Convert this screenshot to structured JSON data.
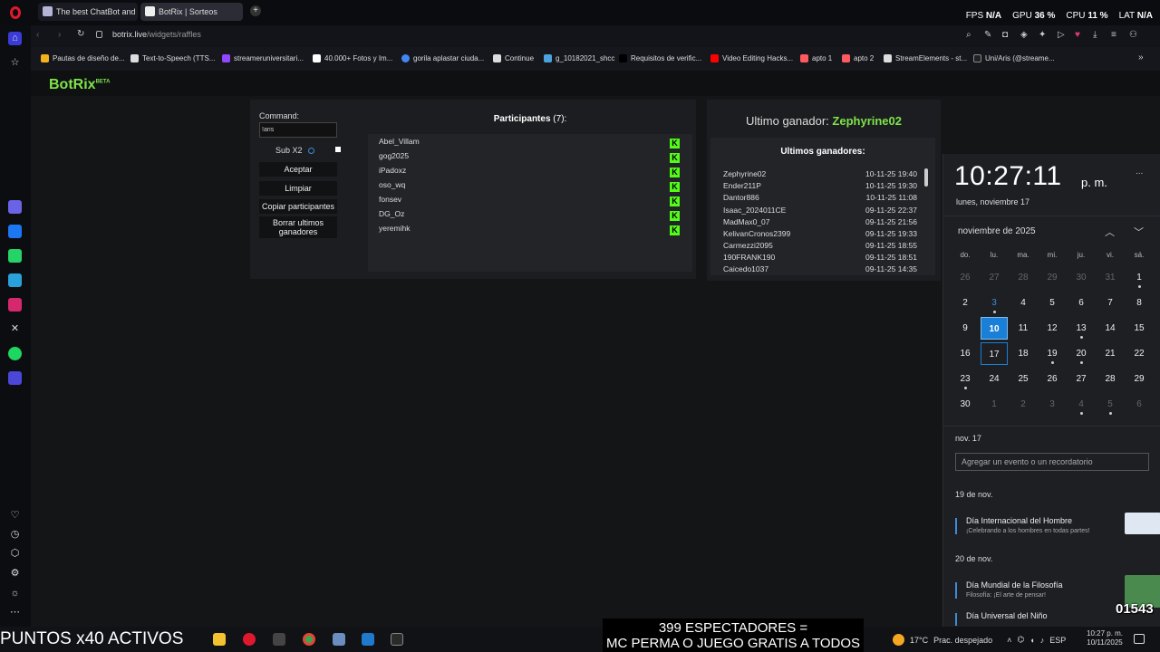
{
  "browser": {
    "tabs": [
      {
        "label": "The best ChatBot and Wi"
      },
      {
        "label": "BotRix | Sorteos"
      }
    ],
    "perf": {
      "fps_label": "FPS",
      "fps": "N/A",
      "gpu_label": "GPU",
      "gpu": "36 %",
      "cpu_label": "CPU",
      "cpu": "11 %",
      "lat_label": "LAT",
      "lat": "N/A"
    },
    "url_host": "botrix.live",
    "url_path": "/widgets/raffles",
    "bookmarks": [
      "Pautas de diseño de...",
      "Text-to-Speech (TTS...",
      "streameruniversitari...",
      "40.000+ Fotos y Im...",
      "gorila aplastar ciuda...",
      "Continue",
      "g_10182021_shcc",
      "Requisitos de verific...",
      "Video Editing Hacks...",
      "apto 1",
      "apto 2",
      "StreamElements - st...",
      "Uni/Aris (@streame..."
    ]
  },
  "app": {
    "logo": "BotRix",
    "logo_badge": "BETA"
  },
  "raffle": {
    "command_label": "Command:",
    "command_value": "!aris",
    "sub_x2_label": "Sub X2",
    "buttons": {
      "accept": "Aceptar",
      "clear": "Limpiar",
      "copy": "Copiar participantes",
      "delete_winners": "Borrar ultimos ganadores"
    },
    "participants_title": "Participantes",
    "participants_count": "(7):",
    "participants": [
      "Abel_Villam",
      "gog2025",
      "iPadoxz",
      "oso_wq",
      "fonsev",
      "DG_Oz",
      "yeremihk"
    ]
  },
  "winners": {
    "last_winner_label": "Ultimo ganador:",
    "last_winner": "Zephyrine02",
    "list_title": "Ultimos ganadores:",
    "list": [
      {
        "name": "Zephyrine02",
        "date": "10-11-25 19:40"
      },
      {
        "name": "Ender211P",
        "date": "10-11-25 19:30"
      },
      {
        "name": "Dantor886",
        "date": "10-11-25 11:08"
      },
      {
        "name": "Isaac_2024011CE",
        "date": "09-11-25 22:37"
      },
      {
        "name": "MadMax0_07",
        "date": "09-11-25 21:56"
      },
      {
        "name": "KelivanCronos2399",
        "date": "09-11-25 19:33"
      },
      {
        "name": "Carmezzi2095",
        "date": "09-11-25 18:55"
      },
      {
        "name": "190FRANK190",
        "date": "09-11-25 18:51"
      },
      {
        "name": "Caicedo1037",
        "date": "09-11-25 14:35"
      }
    ]
  },
  "calendar": {
    "time": "10:27:11",
    "ampm": "p. m.",
    "more": "...",
    "date_line": "lunes, noviembre 17",
    "month": "noviembre de 2025",
    "weekdays": [
      "do.",
      "lu.",
      "ma.",
      "mi.",
      "ju.",
      "vi.",
      "sá."
    ],
    "weeks": [
      [
        "26",
        "27",
        "28",
        "29",
        "30",
        "31",
        "1"
      ],
      [
        "2",
        "3",
        "4",
        "5",
        "6",
        "7",
        "8"
      ],
      [
        "9",
        "10",
        "11",
        "12",
        "13",
        "14",
        "15"
      ],
      [
        "16",
        "17",
        "18",
        "19",
        "20",
        "21",
        "22"
      ],
      [
        "23",
        "24",
        "25",
        "26",
        "27",
        "28",
        "29"
      ],
      [
        "30",
        "1",
        "2",
        "3",
        "4",
        "5",
        "6"
      ]
    ],
    "selected_day": "10",
    "today": "17",
    "agenda_day": "nov. 17",
    "add_placeholder": "Agregar un evento o un recordatorio",
    "events": [
      {
        "day": "19 de nov.",
        "title": "Día Internacional del Hombre",
        "subtitle": "¡Celebrando a los hombres en todas partes!"
      },
      {
        "day": "20 de nov.",
        "title": "Día Mundial de la Filosofía",
        "subtitle": "Filosofía: ¡El arte de pensar!"
      },
      {
        "day": "",
        "title": "Día Universal del Niño",
        "subtitle": ""
      }
    ]
  },
  "overlay": {
    "points": "PUNTOS x40 ACTIVOS",
    "viewers_line1": "399 ESPECTADORES =",
    "viewers_line2": "MC PERMA O JUEGO GRATIS A TODOS",
    "stream_id": "01543"
  },
  "taskbar": {
    "temp": "17°C",
    "weather": "Prac. despejado",
    "lang": "ESP",
    "clock_time": "10:27 p. m.",
    "clock_date": "10/11/2025"
  },
  "colors": {
    "accent_green": "#7ee34a",
    "kick_green": "#53fc18",
    "calendar_blue": "#1a7fd6"
  }
}
